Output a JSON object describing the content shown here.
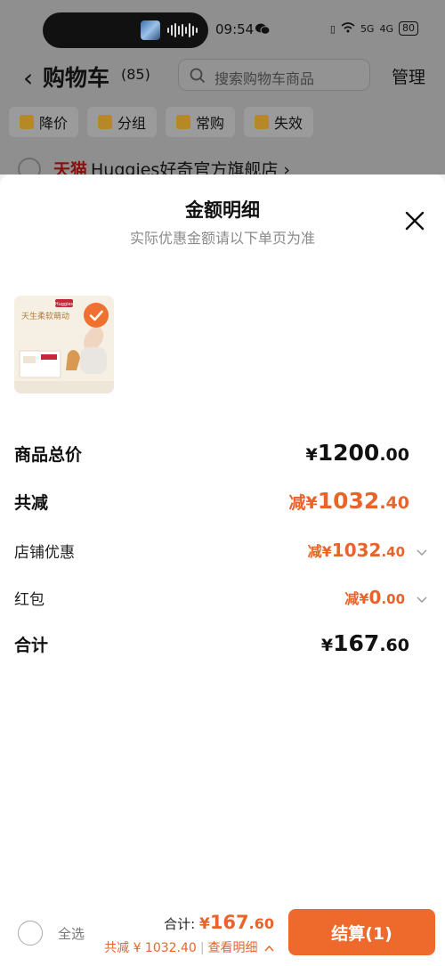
{
  "status_bar": {
    "time": "09:54",
    "network_5g": "5G",
    "network_4g": "4G",
    "battery": "80"
  },
  "cart_header": {
    "back_icon": "chevron-left-icon",
    "title": "购物车",
    "count": "(85)",
    "search_placeholder": "搜索购物车商品",
    "manage_label": "管理"
  },
  "filters": [
    {
      "label": "降价",
      "icon": "price-drop-icon"
    },
    {
      "label": "分组",
      "icon": "folder-icon"
    },
    {
      "label": "常购",
      "icon": "cart-icon"
    },
    {
      "label": "失效",
      "icon": "invalid-icon"
    }
  ],
  "store": {
    "tmall_label": "天猫",
    "name": "Huggies好奇官方旗舰店 ›"
  },
  "sheet": {
    "title": "金额明细",
    "subtitle": "实际优惠金额请以下单页为准",
    "close_icon": "close-icon"
  },
  "product": {
    "brand_tag": "Huggies",
    "slogan": "天生柔软萌动",
    "selected": true
  },
  "breakdown": {
    "total_label": "商品总价",
    "total_sym": "¥",
    "total_int": "1200",
    "total_dec": ".00",
    "reduced_label": "共减",
    "reduced_prefix": "减¥",
    "reduced_int": "1032",
    "reduced_dec": ".40",
    "store_discount_label": "店铺优惠",
    "store_discount_prefix": "减¥",
    "store_discount_int": "1032",
    "store_discount_dec": ".40",
    "redpacket_label": "红包",
    "redpacket_prefix": "减¥",
    "redpacket_int": "0",
    "redpacket_dec": ".00",
    "sum_label": "合计",
    "sum_sym": "¥",
    "sum_int": "167",
    "sum_dec": ".60"
  },
  "bottom_bar": {
    "select_all_label": "全选",
    "total_prefix": "合计:",
    "total_sym": "¥",
    "total_int": "167",
    "total_dec": ".60",
    "discount_text": "共减 ¥ 1032.40",
    "separator": "|",
    "detail_link": "查看明细",
    "checkout_label": "结算(1)"
  },
  "colors": {
    "accent": "#ee6a2c",
    "discount_text": "#e8642a",
    "overlay": "#8f8f8f"
  }
}
